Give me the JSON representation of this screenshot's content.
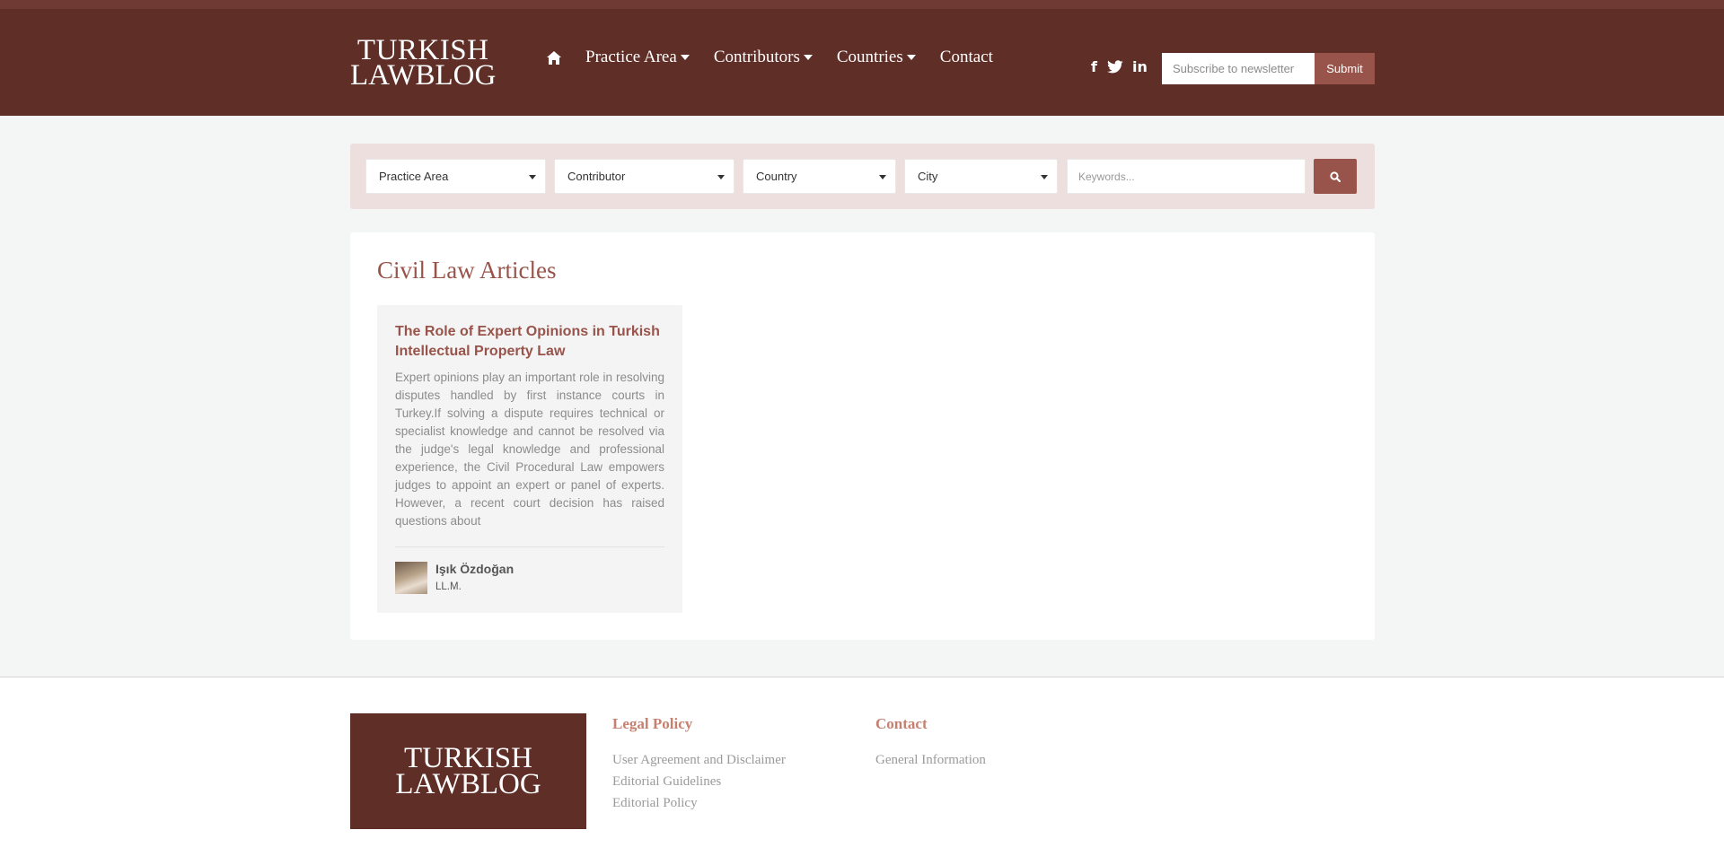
{
  "brand": {
    "logo_line1": "TURKISH",
    "logo_line2": "LAWBLOG"
  },
  "nav": {
    "items": [
      {
        "label": "Practice Area",
        "dropdown": true
      },
      {
        "label": "Contributors",
        "dropdown": true
      },
      {
        "label": "Countries",
        "dropdown": true
      },
      {
        "label": "Contact",
        "dropdown": false
      }
    ]
  },
  "social": {
    "facebook": "f",
    "twitter": "t",
    "linkedin": "in"
  },
  "newsletter": {
    "placeholder": "Subscribe to newsletter",
    "submit_label": "Submit"
  },
  "filters": {
    "practice_area": "Practice Area",
    "contributor": "Contributor",
    "country": "Country",
    "city": "City",
    "keywords_placeholder": "Keywords..."
  },
  "main": {
    "title": "Civil Law Articles",
    "articles": [
      {
        "title": "The Role of Expert Opinions in Turkish Intellectual Property Law",
        "excerpt": "Expert opinions play an important role in resolving disputes handled by first instance courts in Turkey.If solving a dispute requires technical or specialist knowledge and cannot be resolved via the judge's legal knowledge and professional experience, the Civil Procedural Law empowers judges to appoint an expert or panel of experts. However, a recent court decision has raised questions about",
        "author": "Işık Özdoğan",
        "author_title": "LL.M."
      }
    ]
  },
  "footer": {
    "legal_heading": "Legal Policy",
    "legal_links": [
      "User Agreement and Disclaimer",
      "Editorial Guidelines",
      "Editorial Policy"
    ],
    "contact_heading": "Contact",
    "contact_links": [
      "General Information"
    ]
  },
  "colors": {
    "header_bg": "#5f2e27",
    "accent": "#98544a",
    "footer_heading": "#c58070",
    "filter_bg": "#eddfdd"
  }
}
